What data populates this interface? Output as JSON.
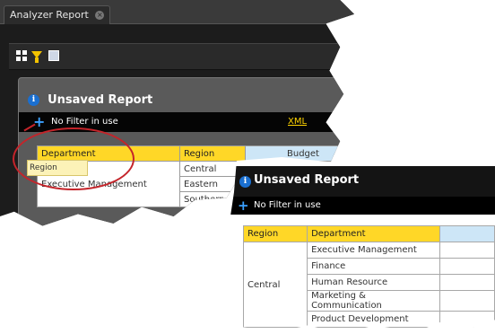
{
  "tab": {
    "title": "Analyzer Report",
    "close_glyph": "×"
  },
  "toolbar": {
    "icons": [
      "grid-icon",
      "filter-icon",
      "properties-icon"
    ]
  },
  "report_back": {
    "title": "Unsaved Report",
    "filter_text": "No Filter in use",
    "xml_link": "XML",
    "headers": [
      "Department",
      "Region",
      "Budget"
    ],
    "rows": [
      [
        "Central"
      ],
      [
        "Eastern"
      ],
      [
        "Southern"
      ]
    ],
    "dept_value": "Executive Management",
    "drag_tooltip": "Region"
  },
  "report_front": {
    "title": "Unsaved Report",
    "filter_text": "No Filter in use",
    "headers": [
      "Region",
      "Department"
    ],
    "region": "Central",
    "departments": [
      "Executive Management",
      "Finance",
      "Human Resource",
      "Marketing & Communication",
      "Product Development"
    ]
  },
  "colors": {
    "header_yellow": "#ffd727",
    "measure_blue": "#cde6f7",
    "annotation_red": "#c4242a"
  }
}
